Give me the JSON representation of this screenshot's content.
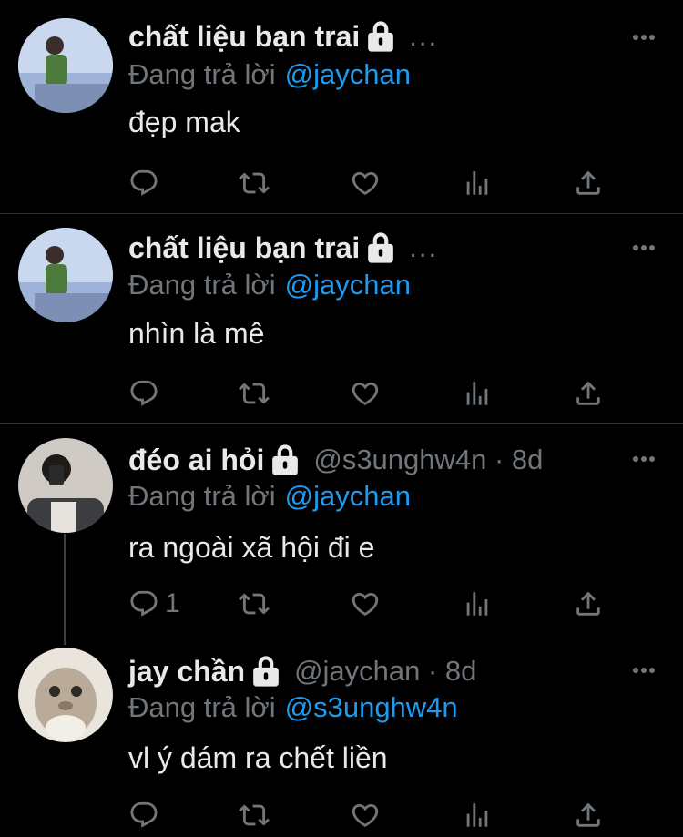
{
  "tweets": [
    {
      "name": "chất liệu bạn trai",
      "handle": "",
      "time": "",
      "overflow": "...",
      "reply_prefix": "Đang trả lời",
      "reply_to": "@jaychan",
      "text": "đẹp mak",
      "reply_count": ""
    },
    {
      "name": "chất liệu bạn trai",
      "handle": "",
      "time": "",
      "overflow": "...",
      "reply_prefix": "Đang trả lời",
      "reply_to": "@jaychan",
      "text": "nhìn là mê",
      "reply_count": ""
    },
    {
      "name": "đéo ai hỏi",
      "handle": "@s3unghw4n · 8d",
      "reply_prefix": "Đang trả lời",
      "reply_to": "@jaychan",
      "text": "ra ngoài xã hội đi e",
      "reply_count": "1"
    },
    {
      "name": "jay chần",
      "handle": "@jaychan · 8d",
      "reply_prefix": "Đang trả lời",
      "reply_to": "@s3unghw4n",
      "text": "vl ý dám ra chết liền",
      "reply_count": ""
    }
  ],
  "icons": {
    "reply": "reply-icon",
    "retweet": "retweet-icon",
    "like": "heart-icon",
    "views": "views-icon",
    "share": "share-icon",
    "more": "more-icon",
    "lock": "lock-icon"
  },
  "colors": {
    "background": "#000000",
    "text": "#e7e9ea",
    "muted": "#71767b",
    "mention": "#1d9bf0",
    "divider": "#2f3336"
  }
}
